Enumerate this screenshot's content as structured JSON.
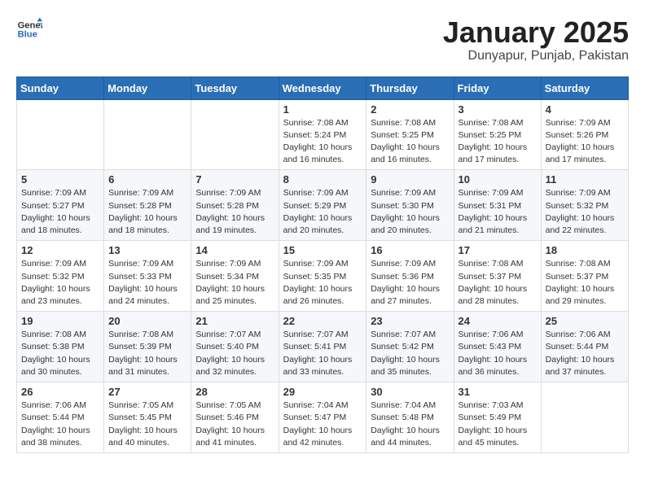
{
  "logo": {
    "general": "General",
    "blue": "Blue"
  },
  "title": "January 2025",
  "subtitle": "Dunyapur, Punjab, Pakistan",
  "weekdays": [
    "Sunday",
    "Monday",
    "Tuesday",
    "Wednesday",
    "Thursday",
    "Friday",
    "Saturday"
  ],
  "weeks": [
    [
      {
        "day": "",
        "info": ""
      },
      {
        "day": "",
        "info": ""
      },
      {
        "day": "",
        "info": ""
      },
      {
        "day": "1",
        "info": "Sunrise: 7:08 AM\nSunset: 5:24 PM\nDaylight: 10 hours\nand 16 minutes."
      },
      {
        "day": "2",
        "info": "Sunrise: 7:08 AM\nSunset: 5:25 PM\nDaylight: 10 hours\nand 16 minutes."
      },
      {
        "day": "3",
        "info": "Sunrise: 7:08 AM\nSunset: 5:25 PM\nDaylight: 10 hours\nand 17 minutes."
      },
      {
        "day": "4",
        "info": "Sunrise: 7:09 AM\nSunset: 5:26 PM\nDaylight: 10 hours\nand 17 minutes."
      }
    ],
    [
      {
        "day": "5",
        "info": "Sunrise: 7:09 AM\nSunset: 5:27 PM\nDaylight: 10 hours\nand 18 minutes."
      },
      {
        "day": "6",
        "info": "Sunrise: 7:09 AM\nSunset: 5:28 PM\nDaylight: 10 hours\nand 18 minutes."
      },
      {
        "day": "7",
        "info": "Sunrise: 7:09 AM\nSunset: 5:28 PM\nDaylight: 10 hours\nand 19 minutes."
      },
      {
        "day": "8",
        "info": "Sunrise: 7:09 AM\nSunset: 5:29 PM\nDaylight: 10 hours\nand 20 minutes."
      },
      {
        "day": "9",
        "info": "Sunrise: 7:09 AM\nSunset: 5:30 PM\nDaylight: 10 hours\nand 20 minutes."
      },
      {
        "day": "10",
        "info": "Sunrise: 7:09 AM\nSunset: 5:31 PM\nDaylight: 10 hours\nand 21 minutes."
      },
      {
        "day": "11",
        "info": "Sunrise: 7:09 AM\nSunset: 5:32 PM\nDaylight: 10 hours\nand 22 minutes."
      }
    ],
    [
      {
        "day": "12",
        "info": "Sunrise: 7:09 AM\nSunset: 5:32 PM\nDaylight: 10 hours\nand 23 minutes."
      },
      {
        "day": "13",
        "info": "Sunrise: 7:09 AM\nSunset: 5:33 PM\nDaylight: 10 hours\nand 24 minutes."
      },
      {
        "day": "14",
        "info": "Sunrise: 7:09 AM\nSunset: 5:34 PM\nDaylight: 10 hours\nand 25 minutes."
      },
      {
        "day": "15",
        "info": "Sunrise: 7:09 AM\nSunset: 5:35 PM\nDaylight: 10 hours\nand 26 minutes."
      },
      {
        "day": "16",
        "info": "Sunrise: 7:09 AM\nSunset: 5:36 PM\nDaylight: 10 hours\nand 27 minutes."
      },
      {
        "day": "17",
        "info": "Sunrise: 7:08 AM\nSunset: 5:37 PM\nDaylight: 10 hours\nand 28 minutes."
      },
      {
        "day": "18",
        "info": "Sunrise: 7:08 AM\nSunset: 5:37 PM\nDaylight: 10 hours\nand 29 minutes."
      }
    ],
    [
      {
        "day": "19",
        "info": "Sunrise: 7:08 AM\nSunset: 5:38 PM\nDaylight: 10 hours\nand 30 minutes."
      },
      {
        "day": "20",
        "info": "Sunrise: 7:08 AM\nSunset: 5:39 PM\nDaylight: 10 hours\nand 31 minutes."
      },
      {
        "day": "21",
        "info": "Sunrise: 7:07 AM\nSunset: 5:40 PM\nDaylight: 10 hours\nand 32 minutes."
      },
      {
        "day": "22",
        "info": "Sunrise: 7:07 AM\nSunset: 5:41 PM\nDaylight: 10 hours\nand 33 minutes."
      },
      {
        "day": "23",
        "info": "Sunrise: 7:07 AM\nSunset: 5:42 PM\nDaylight: 10 hours\nand 35 minutes."
      },
      {
        "day": "24",
        "info": "Sunrise: 7:06 AM\nSunset: 5:43 PM\nDaylight: 10 hours\nand 36 minutes."
      },
      {
        "day": "25",
        "info": "Sunrise: 7:06 AM\nSunset: 5:44 PM\nDaylight: 10 hours\nand 37 minutes."
      }
    ],
    [
      {
        "day": "26",
        "info": "Sunrise: 7:06 AM\nSunset: 5:44 PM\nDaylight: 10 hours\nand 38 minutes."
      },
      {
        "day": "27",
        "info": "Sunrise: 7:05 AM\nSunset: 5:45 PM\nDaylight: 10 hours\nand 40 minutes."
      },
      {
        "day": "28",
        "info": "Sunrise: 7:05 AM\nSunset: 5:46 PM\nDaylight: 10 hours\nand 41 minutes."
      },
      {
        "day": "29",
        "info": "Sunrise: 7:04 AM\nSunset: 5:47 PM\nDaylight: 10 hours\nand 42 minutes."
      },
      {
        "day": "30",
        "info": "Sunrise: 7:04 AM\nSunset: 5:48 PM\nDaylight: 10 hours\nand 44 minutes."
      },
      {
        "day": "31",
        "info": "Sunrise: 7:03 AM\nSunset: 5:49 PM\nDaylight: 10 hours\nand 45 minutes."
      },
      {
        "day": "",
        "info": ""
      }
    ]
  ]
}
